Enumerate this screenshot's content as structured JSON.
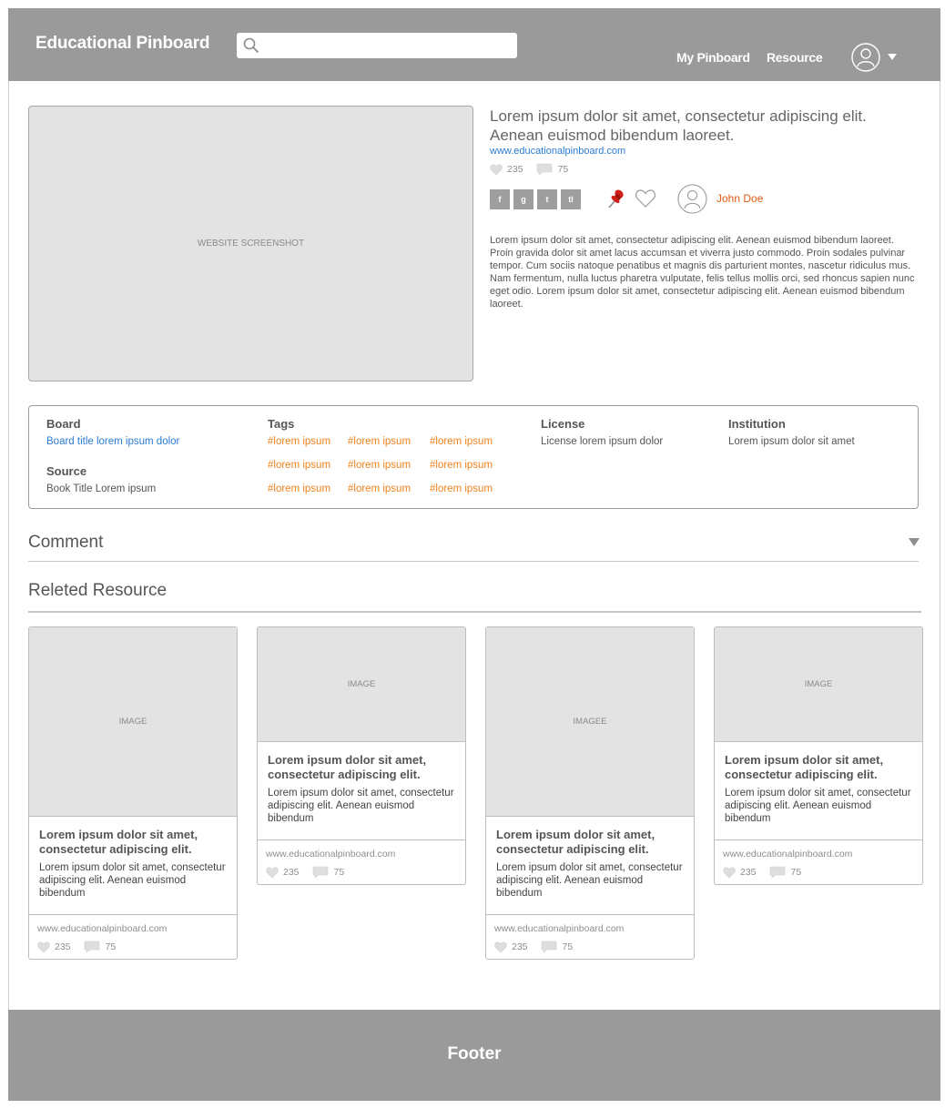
{
  "header": {
    "brand": "Educational Pinboard",
    "search_placeholder": "",
    "nav": {
      "my_pinboard": "My Pinboard",
      "resource": "Resource"
    }
  },
  "resource": {
    "screenshot_label": "WEBSITE SCREENSHOT",
    "title": "Lorem ipsum dolor sit amet, consectetur adipiscing elit. Aenean euismod bibendum laoreet.",
    "url": "www.educationalpinboard.com",
    "likes": "235",
    "comments": "75",
    "social": [
      "f",
      "g",
      "t",
      "tl"
    ],
    "author": "John Doe",
    "description": "Lorem ipsum dolor sit amet, consectetur adipiscing elit. Aenean euismod bibendum laoreet. Proin gravida dolor sit amet lacus accumsan et viverra justo commodo. Proin sodales pulvinar tempor. Cum sociis natoque penatibus et magnis dis parturient montes, nascetur ridiculus mus. Nam fermentum, nulla luctus pharetra vulputate, felis tellus mollis orci, sed rhoncus sapien nunc eget odio. Lorem ipsum dolor sit amet, consectetur adipiscing elit. Aenean euismod bibendum laoreet."
  },
  "info": {
    "board_label": "Board",
    "board_value": "Board title lorem ipsum dolor",
    "source_label": "Source",
    "source_value": "Book Title Lorem ipsum",
    "tags_label": "Tags",
    "tags": [
      "#lorem ipsum",
      "#lorem ipsum",
      "#lorem ipsum",
      "#lorem ipsum",
      "#lorem ipsum",
      "#lorem ipsum",
      "#lorem ipsum",
      "#lorem ipsum",
      "#lorem ipsum"
    ],
    "license_label": "License",
    "license_value": "License lorem ipsum dolor",
    "institution_label": "Institution",
    "institution_value": "Lorem ipsum dolor sit amet"
  },
  "comment": {
    "title": "Comment"
  },
  "related": {
    "title": "Releted Resource",
    "cards": [
      {
        "image": "IMAGE",
        "title": "Lorem ipsum dolor sit amet, consectetur adipiscing elit.",
        "text": "Lorem ipsum dolor sit amet, consectetur adipiscing elit. Aenean euismod bibendum",
        "url": "www.educationalpinboard.com",
        "likes": "235",
        "comments": "75"
      },
      {
        "image": "IMAGE",
        "title": "Lorem ipsum dolor sit amet, consectetur adipiscing elit.",
        "text": "Lorem ipsum dolor sit amet, consectetur adipiscing elit. Aenean euismod bibendum",
        "url": "www.educationalpinboard.com",
        "likes": "235",
        "comments": "75"
      },
      {
        "image": "IMAGEE",
        "title": "Lorem ipsum dolor sit amet, consectetur adipiscing elit.",
        "text": "Lorem ipsum dolor sit amet, consectetur adipiscing elit. Aenean euismod bibendum",
        "url": "www.educationalpinboard.com",
        "likes": "235",
        "comments": "75"
      },
      {
        "image": "IMAGE",
        "title": "Lorem ipsum dolor sit amet, consectetur adipiscing elit.",
        "text": "Lorem ipsum dolor sit amet, consectetur adipiscing elit. Aenean euismod bibendum",
        "url": "www.educationalpinboard.com",
        "likes": "235",
        "comments": "75"
      }
    ]
  },
  "footer": {
    "text": "Footer"
  },
  "colors": {
    "header_bg": "#9a9a9a",
    "link_blue": "#2b7bd1",
    "tag_orange": "#f0821e",
    "author_orange": "#e05a10",
    "pin_red": "#d0201a"
  }
}
